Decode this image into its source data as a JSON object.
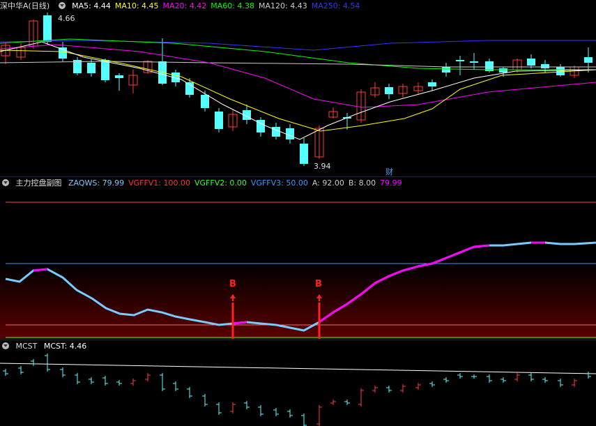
{
  "main_panel": {
    "title": "深中华A(日线)",
    "indicators": [
      {
        "label": "MA5:",
        "value": "4.44",
        "color": "#ffffff"
      },
      {
        "label": "MA10:",
        "value": "4.45",
        "color": "#ffff00"
      },
      {
        "label": "MA20:",
        "value": "4.42",
        "color": "#ff00ff"
      },
      {
        "label": "MA60:",
        "value": "4.38",
        "color": "#00ff00"
      },
      {
        "label": "MA120:",
        "value": "4.43",
        "color": "#cccccc"
      },
      {
        "label": "MA250:",
        "value": "4.54",
        "color": "#3333ff"
      }
    ],
    "high_label": "4.66",
    "low_label": "3.94",
    "event_label": "财"
  },
  "sub_panel": {
    "title": "主力控盘副图",
    "indicators": [
      {
        "label": "ZAQWS:",
        "value": "79.99",
        "color": "#77ccff"
      },
      {
        "label": "VGFFV1:",
        "value": "100.00",
        "color": "#ff3333"
      },
      {
        "label": "VGFFV2:",
        "value": "0.00",
        "color": "#33ff33"
      },
      {
        "label": "VGFFV3:",
        "value": "50.00",
        "color": "#3399ff"
      },
      {
        "label": "A:",
        "value": "92.00",
        "color": "#cccccc"
      },
      {
        "label": "B:",
        "value": "8.00",
        "color": "#cccccc"
      },
      {
        "label": "",
        "value": "79.99",
        "color": "#ff00ff"
      }
    ],
    "signal_label": "B"
  },
  "mcst_panel": {
    "title": "MCST",
    "indicators": [
      {
        "label": "MCST:",
        "value": "4.46",
        "color": "#ffffff"
      }
    ]
  },
  "colors": {
    "up": "#ff3b3b",
    "down": "#54ffff",
    "ma5": "#ffffff",
    "ma10": "#ffff00",
    "ma20": "#ff00ff",
    "ma60": "#00ff00",
    "ma120": "#cccccc",
    "ma250": "#3333ff"
  }
}
